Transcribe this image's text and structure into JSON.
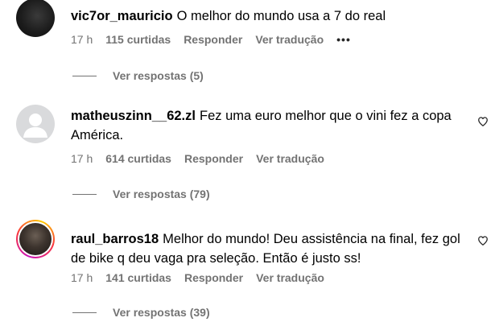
{
  "comments": [
    {
      "username": "vic7or_mauricio",
      "text": "O melhor do mundo usa a 7 do real",
      "time": "17 h",
      "likes": "115 curtidas",
      "reply_label": "Responder",
      "translate_label": "Ver tradução",
      "more_label": "•••",
      "replies_label": "Ver respostas (5)",
      "avatar": "dark-photo"
    },
    {
      "username": "matheuszinn__62.zl",
      "text": "Fez uma euro melhor que o vini fez a copa América.",
      "time": "17 h",
      "likes": "614 curtidas",
      "reply_label": "Responder",
      "translate_label": "Ver tradução",
      "replies_label": "Ver respostas (79)",
      "avatar": "default-user-icon"
    },
    {
      "username": "raul_barros18",
      "text": "Melhor do mundo! Deu assistência na final, fez gol de bike q deu vaga pra seleção. Então é justo ss!",
      "time": "17 h",
      "likes": "141 curtidas",
      "reply_label": "Responder",
      "translate_label": "Ver tradução",
      "replies_label": "Ver respostas (39)",
      "avatar": "story-ring-photo"
    }
  ],
  "icons": {
    "like": "heart-outline-icon"
  },
  "colors": {
    "text": "#000000",
    "secondary": "#737373",
    "default_avatar": "#d9dadc"
  }
}
